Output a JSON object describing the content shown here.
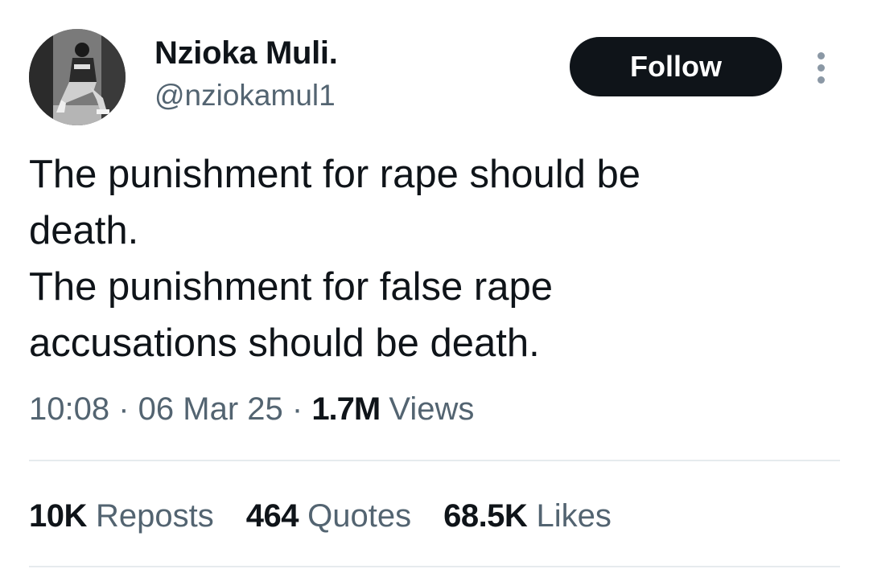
{
  "author": {
    "display_name": "Nzioka Muli.",
    "handle": "@nziokamul1"
  },
  "follow_label": "Follow",
  "more_icon": "more-vertical-icon",
  "tweet": {
    "text": "The punishment for rape should be\ndeath.\nThe punishment for false rape\naccusations should be death."
  },
  "meta": {
    "time": "10:08",
    "sep1": " · ",
    "date": "06 Mar 25",
    "sep2": " · ",
    "views_count": "1.7M",
    "views_label": " Views"
  },
  "stats": {
    "reposts_count": "10K",
    "reposts_label": " Reposts",
    "quotes_count": "464",
    "quotes_label": " Quotes",
    "likes_count": "68.5K",
    "likes_label": " Likes"
  },
  "colors": {
    "text_primary": "#0f1419",
    "text_secondary": "#536471",
    "button_bg": "#0f1419",
    "divider": "#e6ebee"
  }
}
